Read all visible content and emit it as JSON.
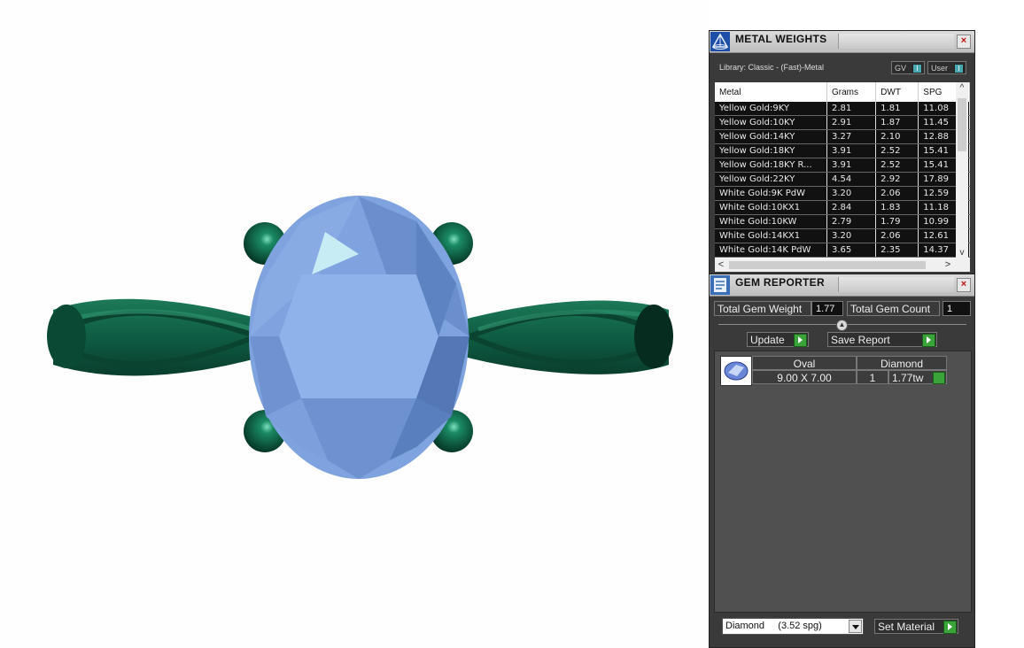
{
  "metal_weights": {
    "title": "METAL WEIGHTS",
    "library_label": "Library: Classic - (Fast)-Metal",
    "gv_label": "GV",
    "user_label": "User",
    "check_mark": "I",
    "close_symbol": "×",
    "columns": [
      "Metal",
      "Grams",
      "DWT",
      "SPG"
    ],
    "rows": [
      [
        "Yellow Gold:9KY",
        "2.81",
        "1.81",
        "11.08"
      ],
      [
        "Yellow Gold:10KY",
        "2.91",
        "1.87",
        "11.45"
      ],
      [
        "Yellow Gold:14KY",
        "3.27",
        "2.10",
        "12.88"
      ],
      [
        "Yellow Gold:18KY",
        "3.91",
        "2.52",
        "15.41"
      ],
      [
        "Yellow Gold:18KY R...",
        "3.91",
        "2.52",
        "15.41"
      ],
      [
        "Yellow Gold:22KY",
        "4.54",
        "2.92",
        "17.89"
      ],
      [
        "White Gold:9K PdW",
        "3.20",
        "2.06",
        "12.59"
      ],
      [
        "White Gold:10KX1",
        "2.84",
        "1.83",
        "11.18"
      ],
      [
        "White Gold:10KW",
        "2.79",
        "1.79",
        "10.99"
      ],
      [
        "White Gold:14KX1",
        "3.20",
        "2.06",
        "12.61"
      ],
      [
        "White Gold:14K PdW",
        "3.65",
        "2.35",
        "14.37"
      ]
    ],
    "scroll_up": "^",
    "scroll_down": "v",
    "scroll_left": "<",
    "scroll_right": ">"
  },
  "gem_reporter": {
    "title": "GEM REPORTER",
    "close_symbol": "×",
    "total_weight_label": "Total Gem Weight",
    "total_weight_value": "1.77",
    "total_count_label": "Total Gem Count",
    "total_count_value": "1",
    "update_label": "Update",
    "save_report_label": "Save Report",
    "gem": {
      "shape": "Oval",
      "material": "Diamond",
      "size": "9.00 X 7.00",
      "count": "1",
      "weight": "1.77tw"
    },
    "material_select_value": "Diamond     (3.52 spg)",
    "set_material_label": "Set Material"
  },
  "viewport": {
    "band_color": "#0e5c43",
    "prong_color": "#0d6b4d",
    "stone_color": "#7fa3de"
  }
}
